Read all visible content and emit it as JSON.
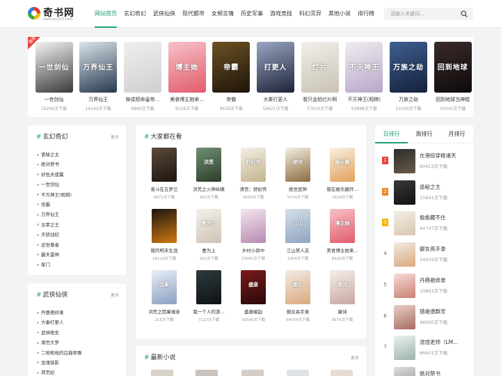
{
  "header": {
    "logo_name": "奇书网",
    "logo_url": "www.qis123.com",
    "nav": [
      "网站首页",
      "玄幻奇幻",
      "武侠仙侠",
      "现代都市",
      "女频言情",
      "历史军事",
      "游戏竞技",
      "科幻灵异",
      "其他小说",
      "排行榜"
    ],
    "active_nav": 0,
    "search_placeholder": "请输入关键词..."
  },
  "banner": {
    "badge": "推荐",
    "books": [
      {
        "title": "一世剑仙",
        "count": "19266次下载",
        "cover_text": "一世剑仙",
        "colors": [
          "#f4f4f4",
          "#3a3a3a"
        ]
      },
      {
        "title": "万界仙王",
        "count": "16243次下载",
        "cover_text": "万界仙王",
        "colors": [
          "#d9e4ec",
          "#27394d"
        ]
      },
      {
        "title": "穿成短命皇帝...",
        "count": "6890次下载",
        "cover_text": "",
        "colors": [
          "#efefef",
          "#cfcfcf"
        ]
      },
      {
        "title": "美食博主她来...",
        "count": "8326次下载",
        "cover_text": "博主她",
        "colors": [
          "#f7c2c8",
          "#e25b6b"
        ]
      },
      {
        "title": "帝霸",
        "count": "9618次下载",
        "cover_text": "帝霸",
        "colors": [
          "#6b5224",
          "#1e140a"
        ]
      },
      {
        "title": "大秦打更人",
        "count": "59621次下载",
        "cover_text": "打更人",
        "colors": [
          "#9aa6c4",
          "#1d2438"
        ]
      },
      {
        "title": "我只会拍烂片啊",
        "count": "57610次下载",
        "cover_text": "烂片",
        "colors": [
          "#f2f0ea",
          "#c8c2b4"
        ]
      },
      {
        "title": "不灭神王(观棋)",
        "count": "63988次下载",
        "cover_text": "不灭神王",
        "colors": [
          "#f0eef0",
          "#b9a5c9"
        ]
      },
      {
        "title": "万族之劫",
        "count": "53100次下载",
        "cover_text": "万族之劫",
        "colors": [
          "#3f5f92",
          "#14213a"
        ]
      },
      {
        "title": "回到地球当神棍",
        "count": "55945次下载",
        "cover_text": "回到地球",
        "colors": [
          "#3b2a2a",
          "#0e0b0b"
        ]
      }
    ]
  },
  "xuanhuan": {
    "title": "玄幻奇幻",
    "more": "更多",
    "items": [
      "诡秘之主",
      "绝对禁书",
      "好色天使翼",
      "一世剑仙",
      "不灭神王(观棋)",
      "帝霸",
      "万界仙王",
      "主宰之王",
      "天骄战纪",
      "逆世尊者",
      "霸天雷神",
      "星门"
    ]
  },
  "wuxia": {
    "title": "武侠仙侠",
    "more": "更多",
    "items": [
      "丹凰艳修录",
      "大秦打更人",
      "武林艳史",
      "诸世大罗",
      "二哈和他的白猫师尊",
      "龙魂侠影",
      "莽荒纪"
    ]
  },
  "watching": {
    "title": "大家都在看",
    "books": [
      {
        "title": "奋斗在五罗兰",
        "count": "6671次下载",
        "cover_text": "",
        "colors": [
          "#5a4a3a",
          "#1e1510"
        ]
      },
      {
        "title": "洪荒之火神纵横",
        "count": "382次下载",
        "cover_text": "洪荒",
        "colors": [
          "#6f8f72",
          "#2c3d2a"
        ]
      },
      {
        "title": "清宫：舒妃传",
        "count": "3426次下载",
        "cover_text": "舒妃传",
        "colors": [
          "#f2efe6",
          "#c4b48d"
        ]
      },
      {
        "title": "绝世武神",
        "count": "5074次下载",
        "cover_text": "绝世",
        "colors": [
          "#f3efe4",
          "#8d6a3d"
        ]
      },
      {
        "title": "我在娱乐圈开...",
        "count": "1824次下载",
        "cover_text": "娱乐圈",
        "colors": [
          "#f8f0e4",
          "#e2a05a"
        ]
      },
      {
        "title": "我的明末生涯",
        "count": "28219次下载",
        "cover_text": "",
        "colors": [
          "#1a1410",
          "#d27b10"
        ]
      },
      {
        "title": "妻为上",
        "count": "192次下载",
        "cover_text": "妻为上",
        "colors": [
          "#f4f0ea",
          "#cfc3b4"
        ]
      },
      {
        "title": "乡村小郎中",
        "count": "10091次下载",
        "cover_text": "",
        "colors": [
          "#f3e6f0",
          "#b689b0"
        ]
      },
      {
        "title": "江山美人志",
        "count": "1354次下载",
        "cover_text": "江山",
        "colors": [
          "#d6e0ea",
          "#8ea3bf"
        ]
      },
      {
        "title": "美食博主她来...",
        "count": "8326次下载",
        "cover_text": "博主她",
        "colors": [
          "#f7c2c8",
          "#e25b6b"
        ]
      },
      {
        "title": "洪荒之因果缠身",
        "count": "215次下载",
        "cover_text": "因果",
        "colors": [
          "#e9eef5",
          "#8aa0c2"
        ]
      },
      {
        "title": "我一个人的游...",
        "count": "7122次下载",
        "cover_text": "",
        "colors": [
          "#2e3a3f",
          "#0d1214"
        ]
      },
      {
        "title": "盛唐崛起",
        "count": "30506次下载",
        "cover_text": "盛唐",
        "colors": [
          "#7a1c1c",
          "#2a0808"
        ]
      },
      {
        "title": "御女高手录",
        "count": "54034次下载",
        "cover_text": "御女",
        "colors": [
          "#f1ece4",
          "#d9a87c"
        ]
      },
      {
        "title": "康诗",
        "count": "8676次下载",
        "cover_text": "康诗",
        "colors": [
          "#f3efea",
          "#c9a6a0"
        ]
      }
    ]
  },
  "newest": {
    "title": "最新小说",
    "more": "更多"
  },
  "ranking": {
    "tabs": [
      "日排行",
      "周排行",
      "月排行"
    ],
    "active_tab": 0,
    "items": [
      {
        "rank": "1",
        "title": "在港综穿梭诸天",
        "count": "80413次下载",
        "colors": [
          "#2c2c2c",
          "#6a5a4a"
        ],
        "badge_color": "#e8463c"
      },
      {
        "rank": "2",
        "title": "诡秘之主",
        "count": "15691次下载",
        "colors": [
          "#3a3a3a",
          "#111111"
        ],
        "badge_color": "#f08a24"
      },
      {
        "rank": "3",
        "title": "偷偷藏不住",
        "count": "44747次下载",
        "colors": [
          "#f4efe8",
          "#d7c6b0"
        ],
        "badge_color": "#f5b50a"
      },
      {
        "rank": "4",
        "title": "御女高手录",
        "count": "54034次下载",
        "colors": [
          "#f1ece4",
          "#d9a87c"
        ],
        "badge_color": ""
      },
      {
        "rank": "5",
        "title": "丹鼎艳修录",
        "count": "10893次下载",
        "colors": [
          "#f6ddd8",
          "#c97f73"
        ],
        "badge_color": ""
      },
      {
        "rank": "6",
        "title": "猎艳谱群芳",
        "count": "48560次下载",
        "colors": [
          "#e8d0c8",
          "#a86a60"
        ],
        "badge_color": ""
      },
      {
        "rank": "7",
        "title": "流氓老师（LM...",
        "count": "86601次下载",
        "colors": [
          "#eef2f0",
          "#9bb3a8"
        ],
        "badge_color": ""
      },
      {
        "rank": "8",
        "title": "绝对禁书",
        "count": "",
        "colors": [
          "#e0e0e0",
          "#8a8a8a"
        ],
        "badge_color": ""
      }
    ]
  }
}
